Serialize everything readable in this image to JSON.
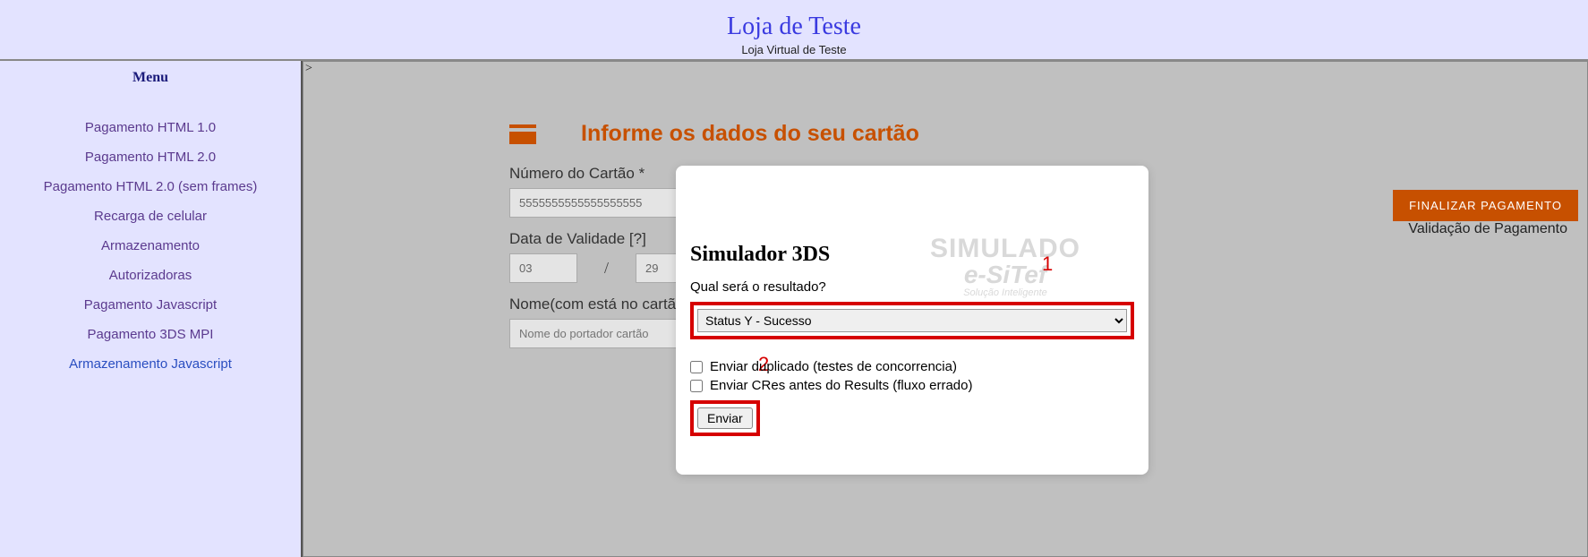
{
  "header": {
    "title": "Loja de Teste",
    "subtitle": "Loja Virtual de Teste"
  },
  "sidebar": {
    "title": "Menu",
    "items": [
      "Pagamento HTML 1.0",
      "Pagamento HTML 2.0",
      "Pagamento HTML 2.0 (sem frames)",
      "Recarga de celular",
      "Armazenamento",
      "Autorizadoras",
      "Pagamento Javascript",
      "Pagamento 3DS MPI",
      "Armazenamento Javascript"
    ]
  },
  "form": {
    "title": "Informe os dados do seu cartão",
    "card_number_label": "Número do Cartão *",
    "card_number_value": "5555555555555555555",
    "expiry_label": "Data de Validade [?]",
    "expiry_month": "03",
    "expiry_year": "29",
    "slash": "/",
    "name_label": "Nome(com está no cartão) *",
    "name_placeholder": "Nome do portador cartão",
    "finalize_button": "FINALIZAR PAGAMENTO",
    "validation_text": "Validação de Pagamento"
  },
  "watermark": {
    "line1": "SIMULADO",
    "line2": "e-SiTef",
    "line3": "Solução Inteligente"
  },
  "modal": {
    "title": "Simulador 3DS",
    "question": "Qual será o resultado?",
    "selected_status": "Status Y - Sucesso",
    "checkbox1": "Enviar duplicado (testes de concorrencia)",
    "checkbox2": "Enviar CRes antes do Results (fluxo errado)",
    "submit": "Enviar"
  },
  "annotations": {
    "one": "1",
    "two": "2"
  },
  "breadcrumb": ">"
}
